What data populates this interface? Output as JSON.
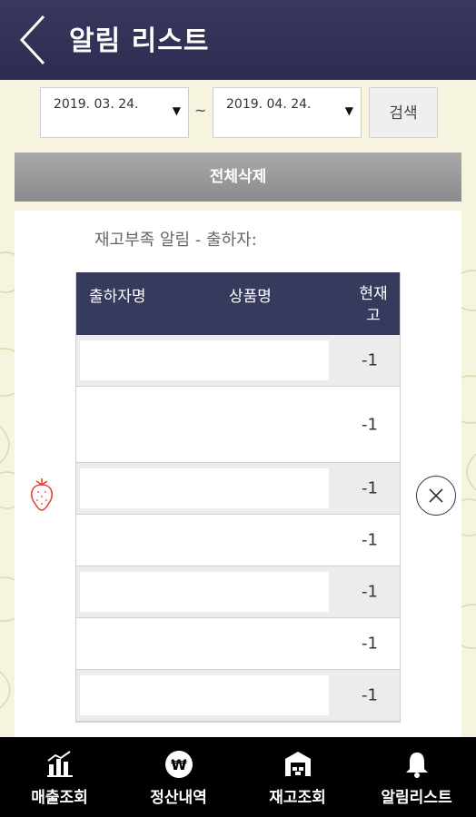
{
  "header": {
    "title": "알림 리스트"
  },
  "filter": {
    "start_date": "2019. 03. 24.",
    "end_date": "2019. 04. 24.",
    "separator": "~",
    "search_label": "검색"
  },
  "actions": {
    "delete_all_label": "전체삭제"
  },
  "alert": {
    "title": "재고부족 알림 - 출하자:",
    "columns": {
      "shipper": "출하자명",
      "product": "상품명",
      "stock_line1": "현재",
      "stock_line2": "고"
    },
    "rows": [
      {
        "shipper": "",
        "product": "",
        "stock": "-1"
      },
      {
        "shipper": "",
        "product": "",
        "stock": "-1"
      },
      {
        "shipper": "",
        "product": "",
        "stock": "-1"
      },
      {
        "shipper": "",
        "product": "",
        "stock": "-1"
      },
      {
        "shipper": "",
        "product": "",
        "stock": "-1"
      },
      {
        "shipper": "",
        "product": "",
        "stock": "-1"
      },
      {
        "shipper": "",
        "product": "",
        "stock": "-1"
      }
    ]
  },
  "nav": {
    "sales": "매출조회",
    "settlement": "정산내역",
    "inventory": "재고조회",
    "alerts": "알림리스트"
  },
  "colors": {
    "header": "#2c2c52",
    "strawberry": "#e0443a"
  }
}
